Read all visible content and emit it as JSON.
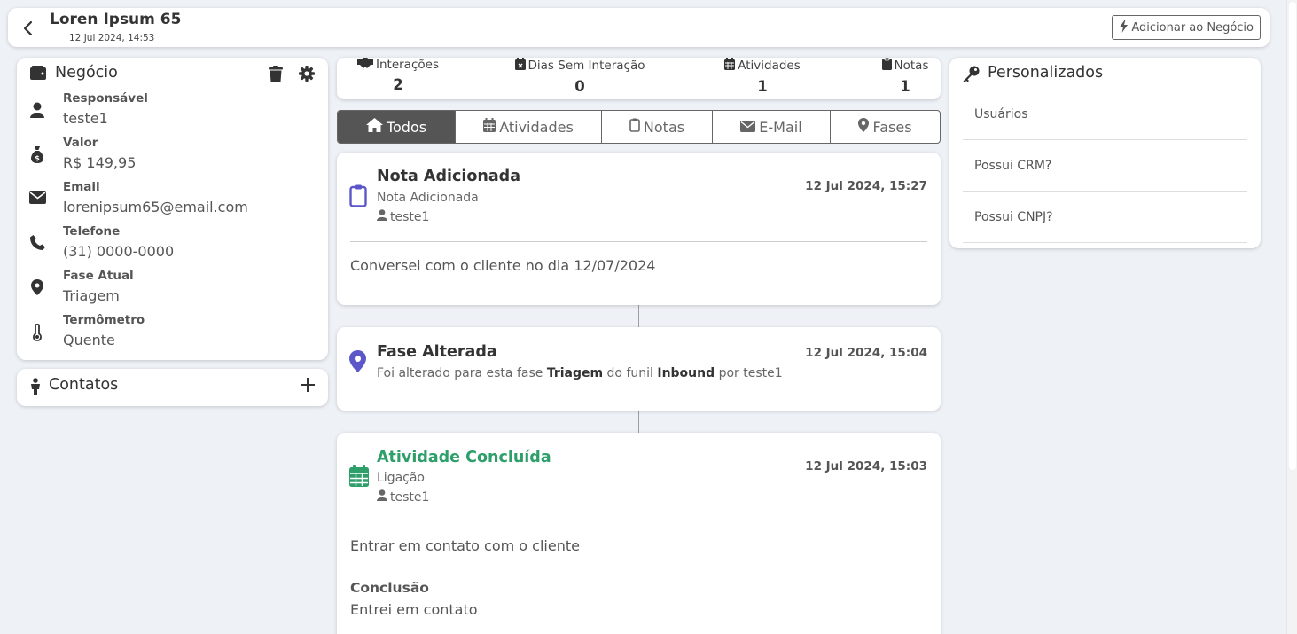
{
  "header": {
    "title": "Loren Ipsum 65",
    "subtitle": "12 Jul 2024, 14:53",
    "add_button": "Adicionar ao Negócio"
  },
  "negocio": {
    "title": "Negócio",
    "fields": [
      {
        "label": "Responsável",
        "value": "teste1",
        "icon": "user-icon"
      },
      {
        "label": "Valor",
        "value": "R$ 149,95",
        "icon": "money-bag-icon"
      },
      {
        "label": "Email",
        "value": "lorenipsum65@email.com",
        "icon": "envelope-icon"
      },
      {
        "label": "Telefone",
        "value": "(31) 0000-0000",
        "icon": "phone-icon"
      },
      {
        "label": "Fase Atual",
        "value": "Triagem",
        "icon": "map-pin-icon"
      },
      {
        "label": "Termômetro",
        "value": "Quente",
        "icon": "thermometer-icon"
      }
    ]
  },
  "contatos": {
    "title": "Contatos"
  },
  "stats": [
    {
      "label": "Interações",
      "value": "2",
      "icon": "handshake-icon"
    },
    {
      "label": "Dias Sem Interação",
      "value": "0",
      "icon": "calendar-x-icon"
    },
    {
      "label": "Atividades",
      "value": "1",
      "icon": "calendar-icon"
    },
    {
      "label": "Notas",
      "value": "1",
      "icon": "clipboard-icon"
    }
  ],
  "tabs": [
    {
      "label": "Todos",
      "icon": "home-icon",
      "active": true
    },
    {
      "label": "Atividades",
      "icon": "calendar-icon"
    },
    {
      "label": "Notas",
      "icon": "clipboard-icon"
    },
    {
      "label": "E-Mail",
      "icon": "envelope-icon"
    },
    {
      "label": "Fases",
      "icon": "map-pin-icon"
    }
  ],
  "timeline": [
    {
      "title": "Nota Adicionada",
      "subtitle": "Nota Adicionada",
      "user": "teste1",
      "date": "12 Jul 2024, 15:27",
      "body": "Conversei com o cliente no dia 12/07/2024",
      "color": "#5b57c9"
    },
    {
      "title": "Fase Alterada",
      "desc_prefix": "Foi alterado para esta fase",
      "phase": "Triagem",
      "desc_mid": "do funil",
      "funnel": "Inbound",
      "desc_suffix": "por teste1",
      "date": "12 Jul 2024, 15:04",
      "color": "#5b57c9"
    },
    {
      "title": "Atividade Concluída",
      "subtitle": "Ligação",
      "user": "teste1",
      "date": "12 Jul 2024, 15:03",
      "body": "Entrar em contato com o cliente",
      "conclusion_label": "Conclusão",
      "conclusion": "Entrei em contato",
      "color": "#2e9e6a"
    }
  ],
  "personalizados": {
    "title": "Personalizados",
    "items": [
      "Usuários",
      "Possui CRM?",
      "Possui CNPJ?"
    ]
  }
}
